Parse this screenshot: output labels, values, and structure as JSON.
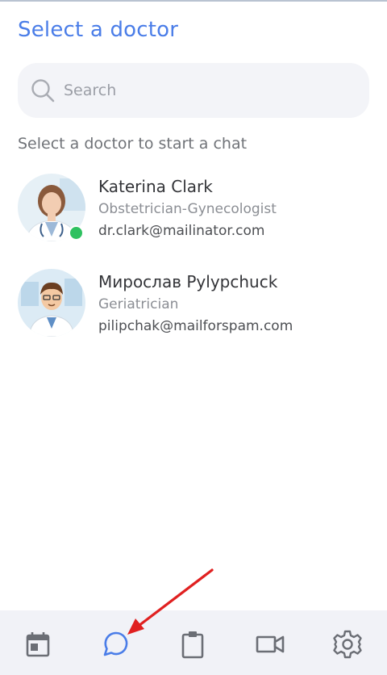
{
  "page": {
    "title": "Select a doctor",
    "subtitle": "Select a doctor to start a chat"
  },
  "search": {
    "placeholder": "Search"
  },
  "doctors": [
    {
      "name": "Katerina Clark",
      "specialty": "Obstetrician-Gynecologist",
      "email": "dr.clark@mailinator.com",
      "online": true
    },
    {
      "name": "Мирослав Pylypchuck",
      "specialty": "Geriatrician",
      "email": "pilipchak@mailforspam.com",
      "online": false
    }
  ],
  "tabbar": {
    "items": [
      {
        "icon": "calendar-icon",
        "active": false
      },
      {
        "icon": "chat-icon",
        "active": true
      },
      {
        "icon": "clipboard-icon",
        "active": false
      },
      {
        "icon": "video-icon",
        "active": false
      },
      {
        "icon": "settings-icon",
        "active": false
      }
    ]
  },
  "colors": {
    "accent": "#4a7de8",
    "online": "#2ec160",
    "annotation_arrow": "#e02020",
    "tab_icon": "#6b6e75",
    "tabbar_bg": "#f1f2f7",
    "search_bg": "#f3f4f8"
  }
}
